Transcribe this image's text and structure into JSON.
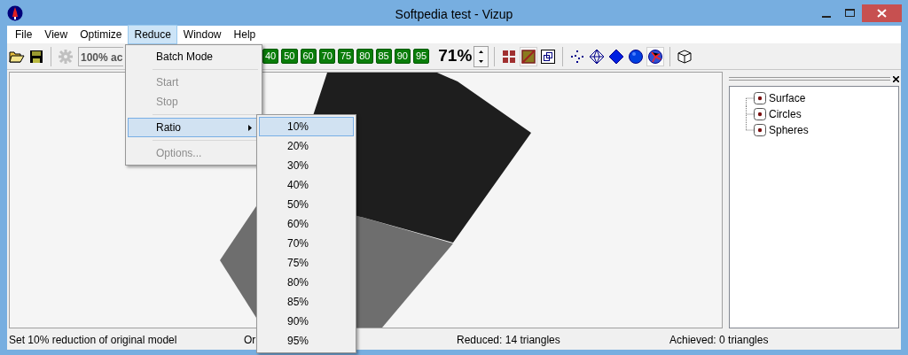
{
  "window": {
    "title": "Softpedia test - Vizup"
  },
  "menu_bar": [
    {
      "label": "File",
      "selected": false
    },
    {
      "label": "View",
      "selected": false
    },
    {
      "label": "Optimize",
      "selected": false
    },
    {
      "label": "Reduce",
      "selected": true
    },
    {
      "label": "Window",
      "selected": false
    },
    {
      "label": "Help",
      "selected": false
    }
  ],
  "toolbar": {
    "file_tools": [
      {
        "kind": "open",
        "disabled": false
      },
      {
        "kind": "save",
        "disabled": false
      },
      {
        "kind": "gear",
        "disabled": true
      }
    ],
    "accuracy_field": "100% ac",
    "ratio_buttons": [
      "40",
      "50",
      "60",
      "70",
      "75",
      "80",
      "85",
      "90",
      "95"
    ],
    "ratio_value": "71%",
    "view_tools": [
      {
        "kind": "grid",
        "pressed": false
      },
      {
        "kind": "diagonal",
        "pressed": true
      },
      {
        "kind": "window",
        "pressed": false
      },
      {
        "kind": "points",
        "pressed": false
      },
      {
        "kind": "wire",
        "pressed": false
      },
      {
        "kind": "solid",
        "pressed": false
      },
      {
        "kind": "sphere",
        "pressed": false
      },
      {
        "kind": "globe",
        "pressed": true
      },
      {
        "kind": "cube",
        "pressed": false
      }
    ]
  },
  "reduce_menu": [
    {
      "kind": "item",
      "label": "Batch Mode",
      "disabled": false,
      "selected": false,
      "submenu": false
    },
    {
      "kind": "separator"
    },
    {
      "kind": "item",
      "label": "Start",
      "disabled": true,
      "selected": false,
      "submenu": false
    },
    {
      "kind": "item",
      "label": "Stop",
      "disabled": true,
      "selected": false,
      "submenu": false
    },
    {
      "kind": "separator"
    },
    {
      "kind": "item",
      "label": "Ratio",
      "disabled": false,
      "selected": true,
      "submenu": true
    },
    {
      "kind": "separator"
    },
    {
      "kind": "item",
      "label": "Options...",
      "disabled": true,
      "selected": false,
      "submenu": false
    }
  ],
  "ratio_submenu": [
    {
      "label": "10%",
      "selected": true
    },
    {
      "label": "20%",
      "selected": false
    },
    {
      "label": "30%",
      "selected": false
    },
    {
      "label": "40%",
      "selected": false
    },
    {
      "label": "50%",
      "selected": false
    },
    {
      "label": "60%",
      "selected": false
    },
    {
      "label": "70%",
      "selected": false
    },
    {
      "label": "75%",
      "selected": false
    },
    {
      "label": "80%",
      "selected": false
    },
    {
      "label": "85%",
      "selected": false
    },
    {
      "label": "90%",
      "selected": false
    },
    {
      "label": "95%",
      "selected": false
    }
  ],
  "tree": [
    {
      "label": "Surface"
    },
    {
      "label": "Circles"
    },
    {
      "label": "Spheres"
    }
  ],
  "status_bar": [
    "Set 10% reduction of original model",
    "Or",
    "Reduced: 14 triangles",
    "Achieved: 0 triangles"
  ]
}
